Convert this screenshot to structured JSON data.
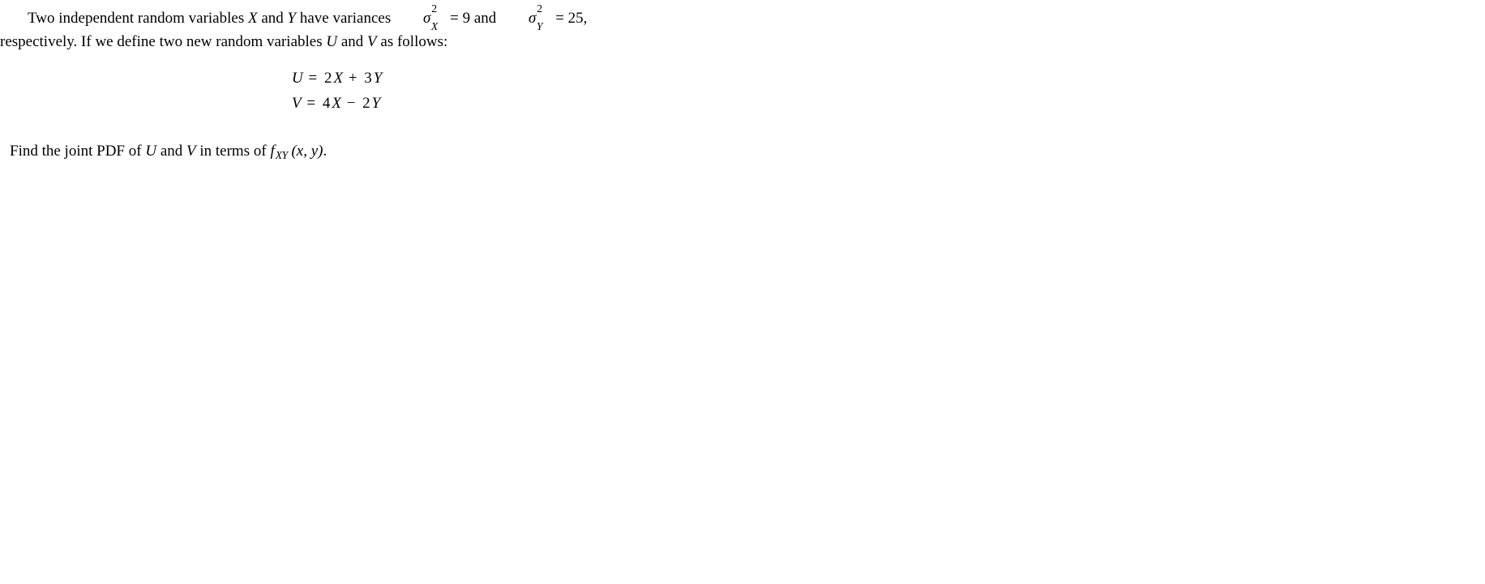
{
  "para1_a": "Two  independent  random  variables ",
  "var_X": "X",
  "and1": " and ",
  "var_Y": "Y",
  "para1_b": " have  variances ",
  "sigma": "σ",
  "sup2": "2",
  "sub_X": "X",
  "eq1_rhs": " = 9",
  "and2": "  and  ",
  "sub_Y": "Y",
  "eq2_rhs": " = 25,",
  "para1_c": "respectively. If we define two new random variables ",
  "var_U": "U",
  "and3": " and ",
  "var_V": "V",
  "para1_d": " as follows:",
  "eq_u_lhs": "U",
  "eq_u_eq": " = ",
  "eq_u_rhs_a": "2",
  "eq_u_rhs_x": "X",
  "eq_u_rhs_plus": " + ",
  "eq_u_rhs_b": "3",
  "eq_u_rhs_y": "Y",
  "eq_v_lhs": "V",
  "eq_v_eq": " = ",
  "eq_v_rhs_a": "4",
  "eq_v_rhs_x": "X",
  "eq_v_rhs_minus": " − ",
  "eq_v_rhs_b": "2",
  "eq_v_rhs_y": "Y",
  "para2_a": "Find the joint PDF of ",
  "para2_b": " in terms of  ",
  "f_letter": "f",
  "f_sub": "XY",
  "f_args": " (x, y)",
  "period": "."
}
